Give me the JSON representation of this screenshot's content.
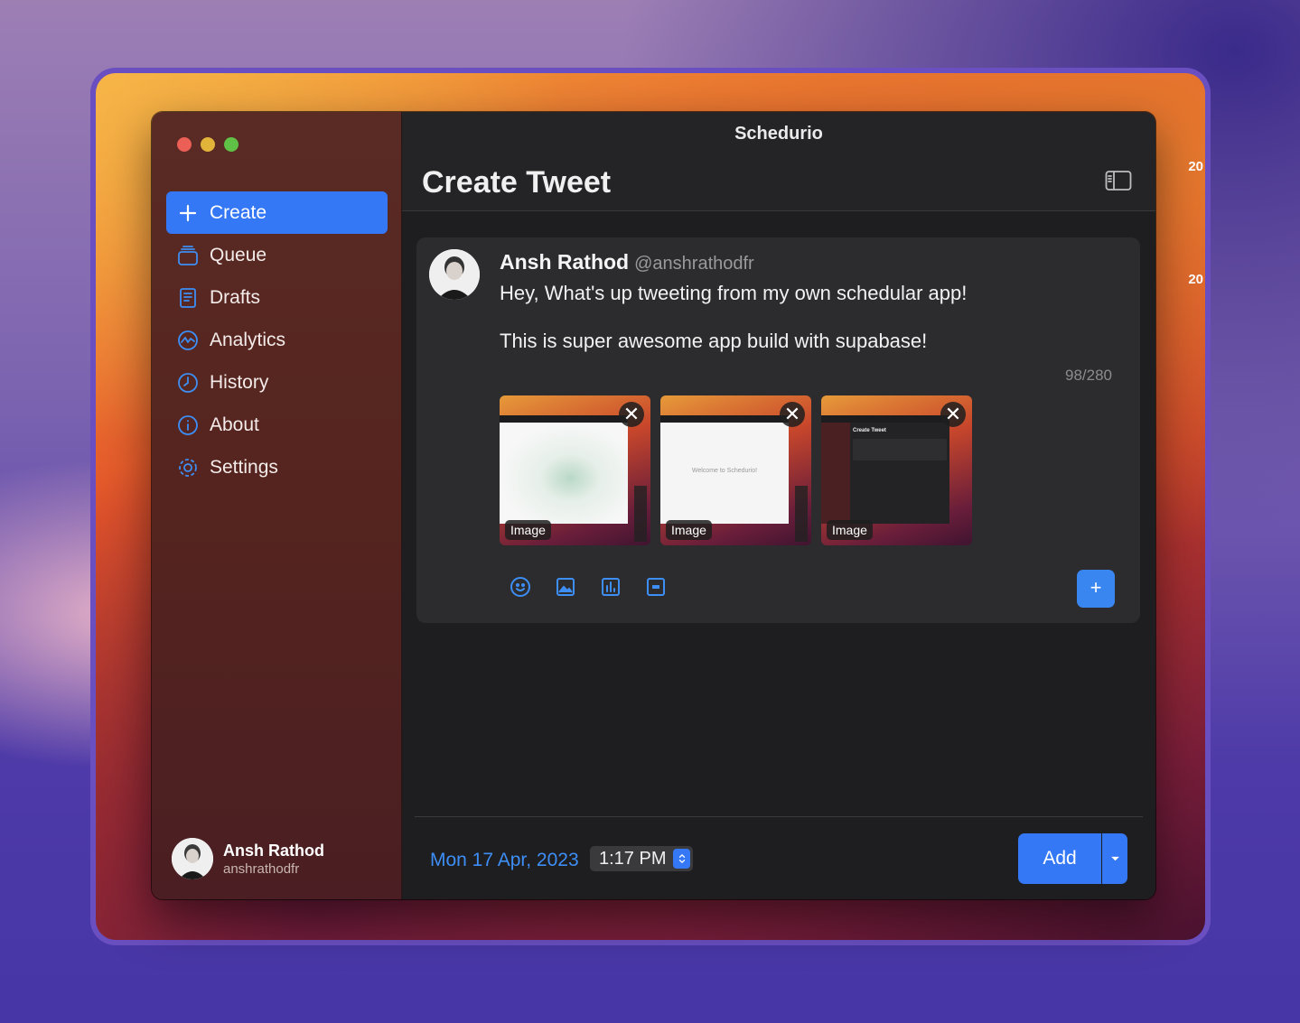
{
  "app_title": "Schedurio",
  "page_title": "Create Tweet",
  "sidebar": {
    "items": [
      {
        "label": "Create",
        "icon": "plus-icon",
        "active": true
      },
      {
        "label": "Queue",
        "icon": "stack-icon"
      },
      {
        "label": "Drafts",
        "icon": "document-icon"
      },
      {
        "label": "Analytics",
        "icon": "chart-line-icon"
      },
      {
        "label": "History",
        "icon": "clock-icon"
      },
      {
        "label": "About",
        "icon": "info-icon"
      },
      {
        "label": "Settings",
        "icon": "gear-icon"
      }
    ],
    "user": {
      "name": "Ansh Rathod",
      "handle": "anshrathodfr"
    }
  },
  "tweet": {
    "author": "Ansh Rathod",
    "handle": "@anshrathodfr",
    "lines": [
      "Hey, What's up tweeting from my own schedular app!",
      "This is super awesome app build with supabase!"
    ],
    "counter": "98/280",
    "images": [
      {
        "label": "Image",
        "close": "✕"
      },
      {
        "label": "Image",
        "close": "✕",
        "caption": "Welcome to Schedurio!"
      },
      {
        "label": "Image",
        "close": "✕",
        "caption": "Create Tweet"
      }
    ],
    "toolbar": [
      "emoji-icon",
      "image-icon",
      "poll-icon",
      "gif-icon"
    ],
    "add_thread": "+"
  },
  "footer": {
    "date": "Mon 17 Apr, 2023",
    "time": "1:17 PM",
    "add_label": "Add"
  },
  "wallpaper_edge": [
    "20",
    "20"
  ],
  "colors": {
    "accent": "#3478f6",
    "date": "#3d8ef5"
  }
}
